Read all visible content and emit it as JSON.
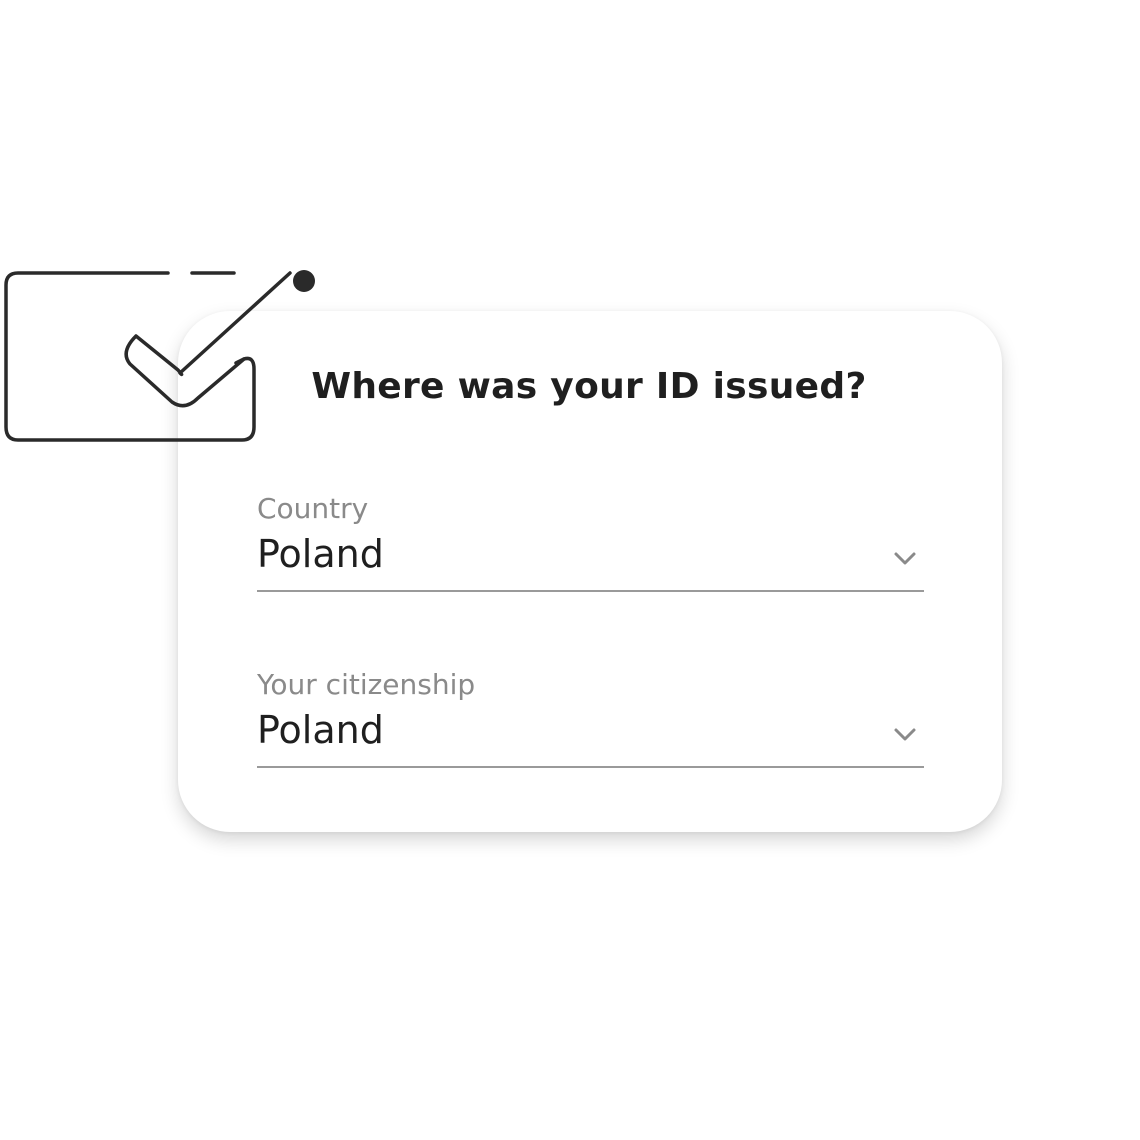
{
  "form": {
    "title": "Where was your ID issued?",
    "fields": [
      {
        "label": "Country",
        "value": "Poland"
      },
      {
        "label": "Your citizenship",
        "value": "Poland"
      }
    ]
  },
  "icons": {
    "illustration": "id-card-checkmark-icon",
    "dropdown": "chevron-down-icon"
  },
  "colors": {
    "text": "#1f1f1f",
    "label": "#8a8a8a",
    "line": "#9a9a9a",
    "illustration_stroke": "#2a2a2a"
  }
}
